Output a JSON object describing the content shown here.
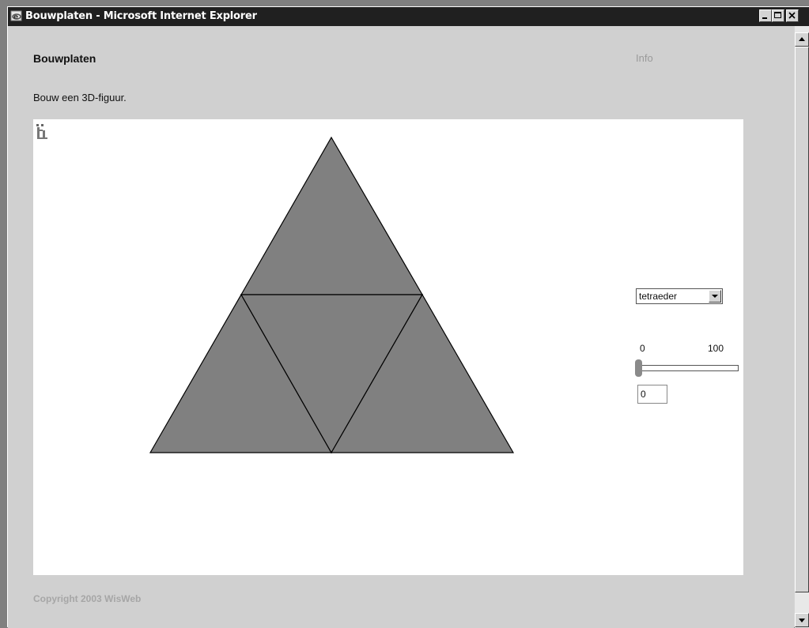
{
  "window": {
    "title": "Bouwplaten - Microsoft Internet Explorer",
    "icon": "ie-icon",
    "controls": [
      "minimize-icon",
      "maximize-icon",
      "close-icon"
    ]
  },
  "page": {
    "title": "Bouwplaten",
    "info_link": "Info",
    "instruction": "Bouw een 3D-figuur.",
    "copyright": "Copyright 2003 WisWeb"
  },
  "applet": {
    "logo_icon": "fi-logo-icon",
    "net": {
      "faces": 4,
      "fill_color": "#808080",
      "edge_color": "#000000"
    },
    "shape_select": {
      "selected": "tetraeder"
    },
    "slider": {
      "min_label": "0",
      "max_label": "100",
      "value": 0
    },
    "value_field": "0"
  },
  "colors": {
    "titlebar": "#202020",
    "background": "#d0d0d0",
    "panel": "#ffffff",
    "muted_text": "#9a9a9a"
  }
}
